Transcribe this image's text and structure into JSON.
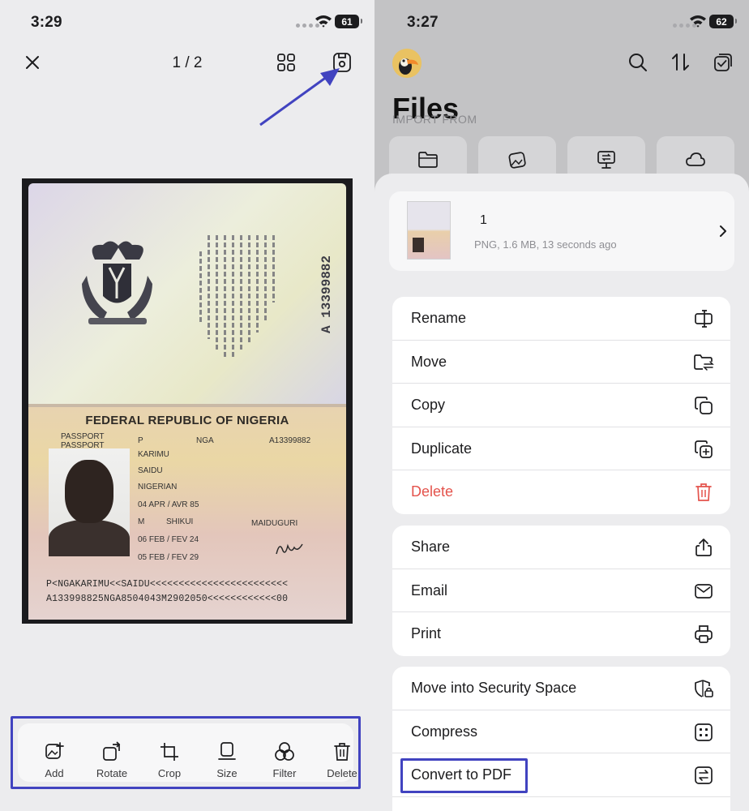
{
  "left": {
    "status": {
      "time": "3:29",
      "battery": "61"
    },
    "header": {
      "pager": "1 / 2"
    },
    "document": {
      "republic": "FEDERAL REPUBLIC OF NIGERIA",
      "passport_label": "PASSPORT",
      "passport_label2": "PASSPORT",
      "type": "P",
      "code": "NGA",
      "number": "A13399882",
      "surname": "KARIMU",
      "given": "SAIDU",
      "nationality": "NIGERIAN",
      "dob": "04 APR / AVR 85",
      "sex": "M",
      "place": "SHIKUI",
      "authority": "MAIDUGURI",
      "issue": "06 FEB / FEV 24",
      "expiry": "05 FEB / FEV 29",
      "vertical_number": "A 13399882",
      "mrz1": "P<NGAKARIMU<<SAIDU<<<<<<<<<<<<<<<<<<<<<<<<",
      "mrz2": "A133998825NGA8504043M2902050<<<<<<<<<<<<00"
    },
    "toolbar": [
      {
        "label": "Add",
        "icon": "add-image-icon"
      },
      {
        "label": "Rotate",
        "icon": "rotate-icon"
      },
      {
        "label": "Crop",
        "icon": "crop-icon"
      },
      {
        "label": "Size",
        "icon": "size-icon"
      },
      {
        "label": "Filter",
        "icon": "filter-icon"
      },
      {
        "label": "Delete",
        "icon": "trash-icon"
      }
    ],
    "accent": "#4143c0"
  },
  "right": {
    "status": {
      "time": "3:27",
      "battery": "62"
    },
    "title": "Files",
    "import_from": "IMPORT FROM",
    "file": {
      "name": "1",
      "meta": "PNG, 1.6 MB, 13 seconds ago"
    },
    "menu_group1": [
      {
        "label": "Rename",
        "icon": "rename-icon"
      },
      {
        "label": "Move",
        "icon": "move-folder-icon"
      },
      {
        "label": "Copy",
        "icon": "copy-icon"
      },
      {
        "label": "Duplicate",
        "icon": "duplicate-icon"
      },
      {
        "label": "Delete",
        "icon": "trash-icon"
      }
    ],
    "menu_group2": [
      {
        "label": "Share",
        "icon": "share-icon"
      },
      {
        "label": "Email",
        "icon": "email-icon"
      },
      {
        "label": "Print",
        "icon": "printer-icon"
      }
    ],
    "menu_group3": [
      {
        "label": "Move into Security Space",
        "icon": "shield-lock-icon"
      },
      {
        "label": "Compress",
        "icon": "compress-icon"
      },
      {
        "label": "Convert to PDF",
        "icon": "convert-icon"
      }
    ],
    "danger_color": "#e4534c"
  }
}
